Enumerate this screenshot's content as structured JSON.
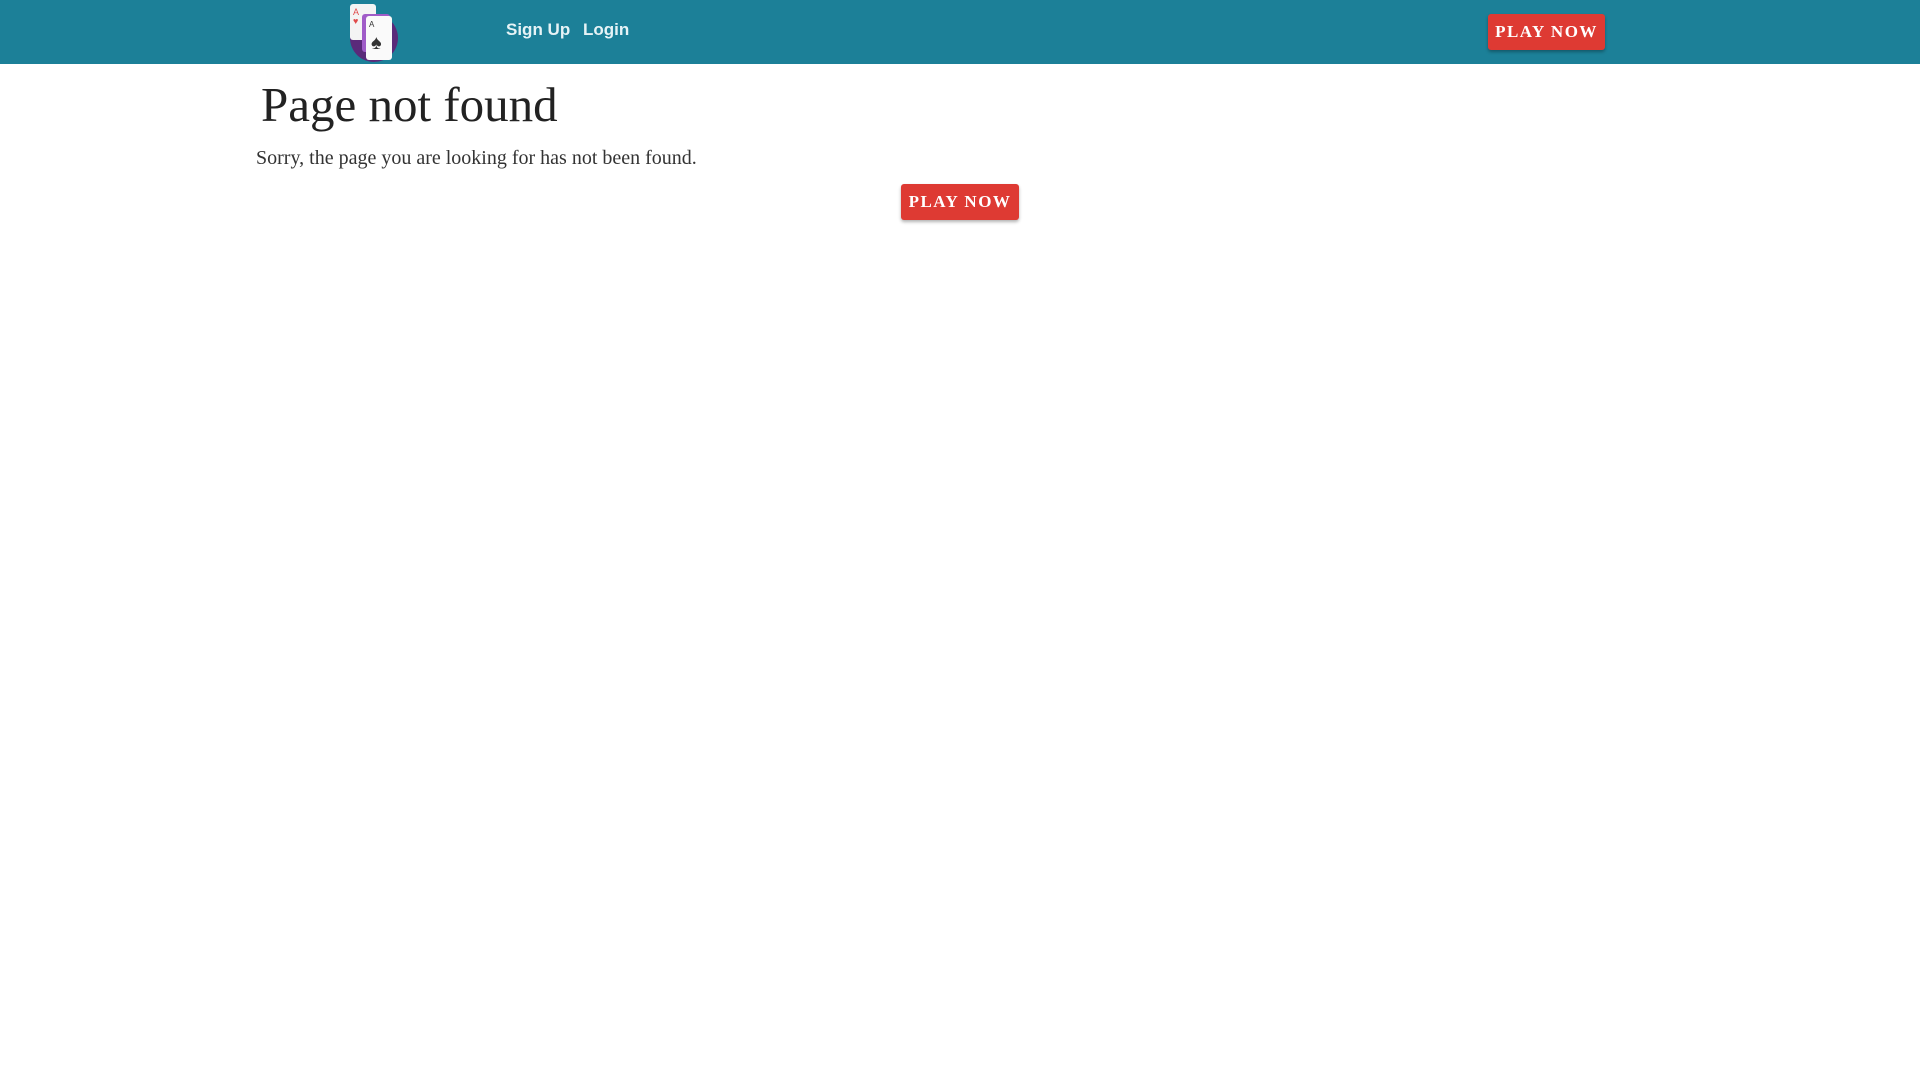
{
  "header": {
    "logo_icon": "playing-cards-logo",
    "nav": [
      {
        "label": "Sign Up"
      },
      {
        "label": "Login"
      }
    ],
    "play_now_label": "PLAY NOW"
  },
  "main": {
    "title": "Page not found",
    "message": "Sorry, the page you are looking for has not been found.",
    "play_now_label": "PLAY NOW"
  },
  "colors": {
    "header": "#1c8098",
    "button": "#de3a33"
  }
}
